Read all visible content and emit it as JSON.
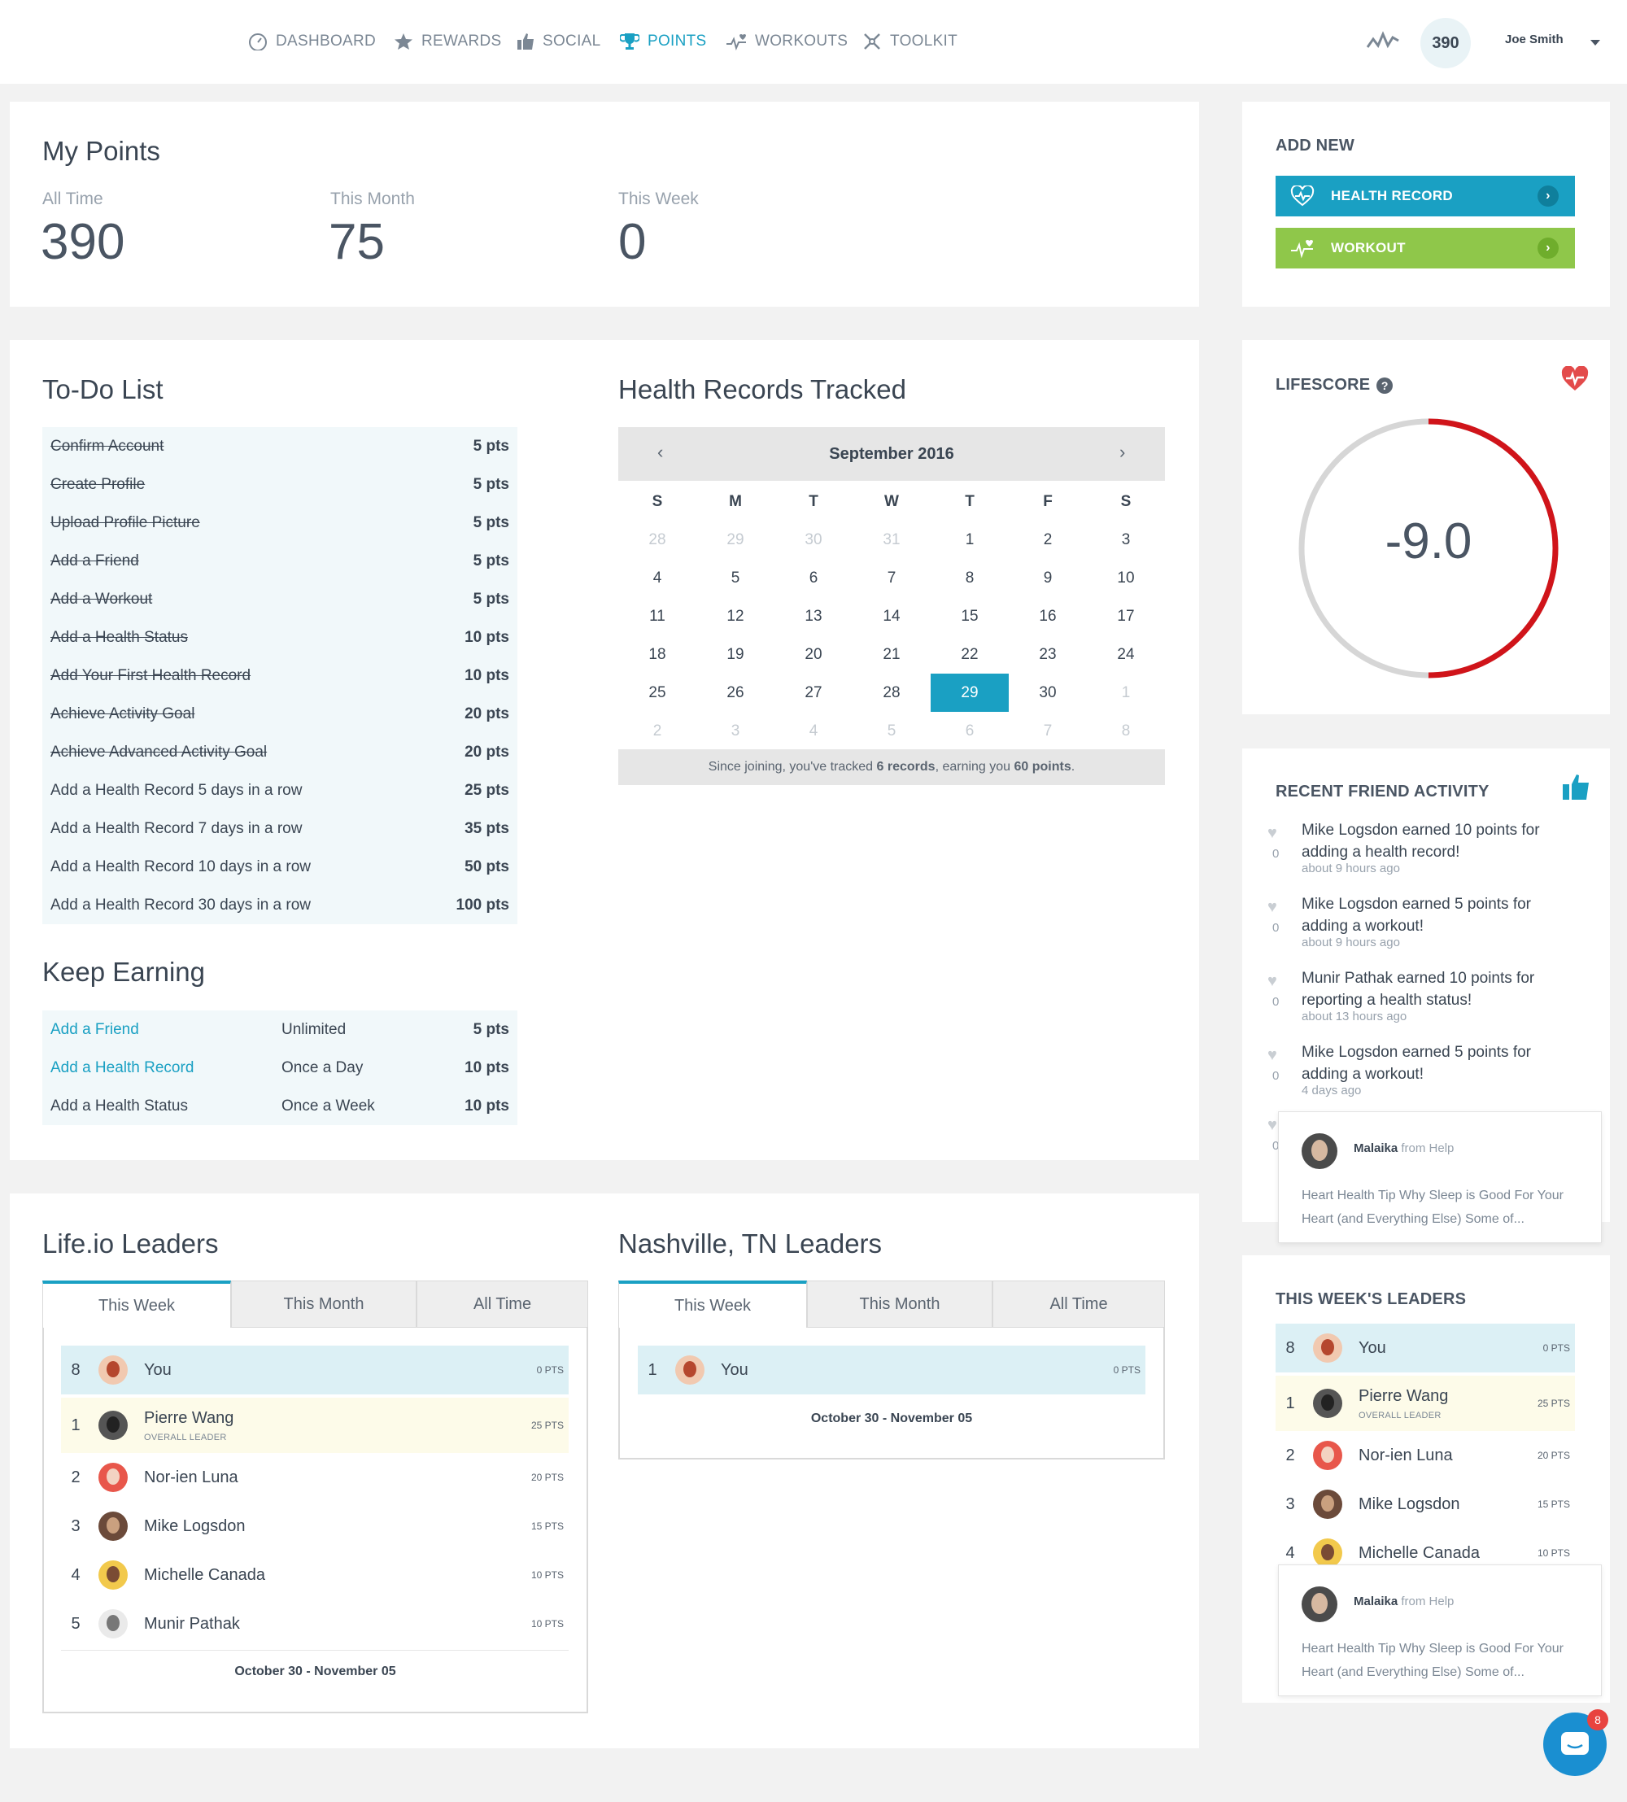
{
  "nav": {
    "items": [
      {
        "label": "DASHBOARD",
        "icon": "gauge-icon"
      },
      {
        "label": "REWARDS",
        "icon": "star-icon"
      },
      {
        "label": "SOCIAL",
        "icon": "thumbs-up-icon"
      },
      {
        "label": "POINTS",
        "icon": "trophy-icon"
      },
      {
        "label": "WORKOUTS",
        "icon": "pulse-heart-icon"
      },
      {
        "label": "TOOLKIT",
        "icon": "tools-icon"
      }
    ],
    "active": "POINTS",
    "points_badge": "390",
    "user_name": "Joe Smith"
  },
  "my_points": {
    "title": "My Points",
    "stats": [
      {
        "label": "All Time",
        "value": "390"
      },
      {
        "label": "This Month",
        "value": "75"
      },
      {
        "label": "This Week",
        "value": "0"
      }
    ]
  },
  "add_new": {
    "title": "ADD NEW",
    "health_record": "HEALTH RECORD",
    "workout": "WORKOUT"
  },
  "todo": {
    "title": "To-Do List",
    "items": [
      {
        "name": "Confirm Account",
        "pts": "5 pts",
        "done": true
      },
      {
        "name": "Create Profile",
        "pts": "5 pts",
        "done": true
      },
      {
        "name": "Upload Profile Picture",
        "pts": "5 pts",
        "done": true
      },
      {
        "name": "Add a Friend",
        "pts": "5 pts",
        "done": true
      },
      {
        "name": "Add a Workout",
        "pts": "5 pts",
        "done": true
      },
      {
        "name": "Add a Health Status",
        "pts": "10 pts",
        "done": true
      },
      {
        "name": "Add Your First Health Record",
        "pts": "10 pts",
        "done": true
      },
      {
        "name": "Achieve Activity Goal",
        "pts": "20 pts",
        "done": true
      },
      {
        "name": "Achieve Advanced Activity Goal",
        "pts": "20 pts",
        "done": true
      },
      {
        "name": "Add a Health Record 5 days in a row",
        "pts": "25 pts",
        "done": false
      },
      {
        "name": "Add a Health Record 7 days in a row",
        "pts": "35 pts",
        "done": false
      },
      {
        "name": "Add a Health Record 10 days in a row",
        "pts": "50 pts",
        "done": false
      },
      {
        "name": "Add a Health Record 30 days in a row",
        "pts": "100 pts",
        "done": false
      }
    ]
  },
  "keep_earning": {
    "title": "Keep Earning",
    "items": [
      {
        "name": "Add a Friend",
        "freq": "Unlimited",
        "pts": "5 pts",
        "link": true
      },
      {
        "name": "Add a Health Record",
        "freq": "Once a Day",
        "pts": "10 pts",
        "link": true
      },
      {
        "name": "Add a Health Status",
        "freq": "Once a Week",
        "pts": "10 pts",
        "link": false
      }
    ]
  },
  "calendar": {
    "title": "Health Records Tracked",
    "month": "September 2016",
    "prev": "‹",
    "next": "›",
    "dow": [
      "S",
      "M",
      "T",
      "W",
      "T",
      "F",
      "S"
    ],
    "weeks": [
      [
        "28",
        "29",
        "30",
        "31",
        "1",
        "2",
        "3"
      ],
      [
        "4",
        "5",
        "6",
        "7",
        "8",
        "9",
        "10"
      ],
      [
        "11",
        "12",
        "13",
        "14",
        "15",
        "16",
        "17"
      ],
      [
        "18",
        "19",
        "20",
        "21",
        "22",
        "23",
        "24"
      ],
      [
        "25",
        "26",
        "27",
        "28",
        "29",
        "30",
        "1"
      ],
      [
        "2",
        "3",
        "4",
        "5",
        "6",
        "7",
        "8"
      ]
    ],
    "today": "29",
    "footer_pre": "Since joining, you've tracked ",
    "footer_records": "6 records",
    "footer_mid": ", earning you ",
    "footer_points": "60 points",
    "footer_end": "."
  },
  "lifescore": {
    "title": "LIFESCORE",
    "value": "-9.0",
    "fraction": 0.5
  },
  "friend_activity": {
    "title": "RECENT FRIEND ACTIVITY",
    "items": [
      {
        "text": "Mike Logsdon earned 10 points for adding a health record!",
        "ago": "about 9 hours ago",
        "likes": "0"
      },
      {
        "text": "Mike Logsdon earned 5 points for adding a workout!",
        "ago": "about 9 hours ago",
        "likes": "0"
      },
      {
        "text": "Munir Pathak earned 10 points for reporting a health status!",
        "ago": "about 13 hours ago",
        "likes": "0"
      },
      {
        "text": "Mike Logsdon earned 5 points for adding a workout!",
        "ago": "4 days ago",
        "likes": "0"
      }
    ],
    "partial_likes": "0"
  },
  "help_popup": {
    "name": "Malaika",
    "from": "from Help",
    "message": "Heart Health Tip Why Sleep is Good For Your Heart (and Everything Else) Some of..."
  },
  "lifeio_leaders": {
    "title": "Life.io Leaders",
    "tabs": [
      "This Week",
      "This Month",
      "All Time"
    ],
    "rows": [
      {
        "rank": "8",
        "name": "You",
        "pts": "0 PTS",
        "sub": ""
      },
      {
        "rank": "1",
        "name": "Pierre Wang",
        "pts": "25 PTS",
        "sub": "OVERALL LEADER"
      },
      {
        "rank": "2",
        "name": "Nor-ien Luna",
        "pts": "20 PTS",
        "sub": ""
      },
      {
        "rank": "3",
        "name": "Mike Logsdon",
        "pts": "15 PTS",
        "sub": ""
      },
      {
        "rank": "4",
        "name": "Michelle Canada",
        "pts": "10 PTS",
        "sub": ""
      },
      {
        "rank": "5",
        "name": "Munir Pathak",
        "pts": "10 PTS",
        "sub": ""
      }
    ],
    "date_range": "October 30 - November 05"
  },
  "nashville_leaders": {
    "title": "Nashville, TN Leaders",
    "tabs": [
      "This Week",
      "This Month",
      "All Time"
    ],
    "rows": [
      {
        "rank": "1",
        "name": "You",
        "pts": "0 PTS"
      }
    ],
    "date_range": "October 30 - November 05"
  },
  "week_leaders": {
    "title": "THIS WEEK'S LEADERS",
    "rows": [
      {
        "rank": "8",
        "name": "You",
        "pts": "0 PTS",
        "sub": ""
      },
      {
        "rank": "1",
        "name": "Pierre Wang",
        "pts": "25 PTS",
        "sub": "OVERALL LEADER"
      },
      {
        "rank": "2",
        "name": "Nor-ien Luna",
        "pts": "20 PTS",
        "sub": ""
      },
      {
        "rank": "3",
        "name": "Mike Logsdon",
        "pts": "15 PTS",
        "sub": ""
      },
      {
        "rank": "4",
        "name": "Michelle Canada",
        "pts": "10 PTS",
        "sub": ""
      }
    ]
  },
  "chat": {
    "badge": "8"
  },
  "colors": {
    "accent": "#1aa0c3",
    "green": "#8fc74a",
    "red": "#d0141a",
    "highlight": "#dcf0f5",
    "leader": "#fdfbe9"
  }
}
